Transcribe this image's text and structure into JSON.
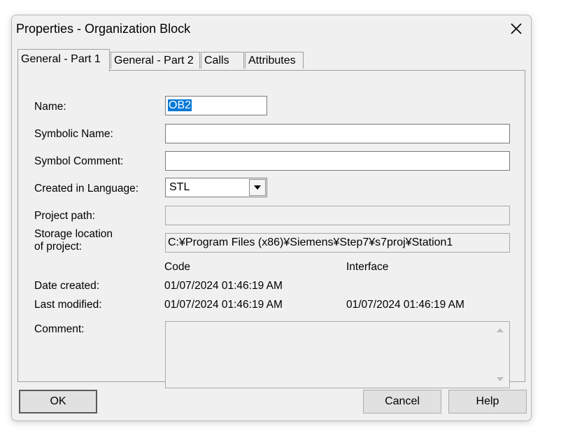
{
  "dialog": {
    "title": "Properties - Organization Block"
  },
  "tabs": [
    {
      "label": "General - Part 1",
      "active": true
    },
    {
      "label": "General - Part 2",
      "active": false
    },
    {
      "label": "Calls",
      "active": false
    },
    {
      "label": "Attributes",
      "active": false
    }
  ],
  "form": {
    "name_label": "Name:",
    "name_value": "OB2",
    "symbolic_name_label": "Symbolic Name:",
    "symbolic_name_value": "",
    "symbol_comment_label": "Symbol Comment:",
    "symbol_comment_value": "",
    "language_label": "Created in Language:",
    "language_value": "STL",
    "project_path_label": "Project path:",
    "project_path_value": "",
    "storage_label_line1": "Storage location",
    "storage_label_line2": "of project:",
    "storage_value": "C:¥Program Files (x86)¥Siemens¥Step7¥s7proj¥Station1",
    "code_header": "Code",
    "interface_header": "Interface",
    "date_created_label": "Date created:",
    "date_created_code": "01/07/2024 01:46:19 AM",
    "last_modified_label": "Last modified:",
    "last_modified_code": "01/07/2024 01:46:19 AM",
    "last_modified_interface": "01/07/2024 01:46:19 AM",
    "comment_label": "Comment:",
    "comment_value": ""
  },
  "buttons": {
    "ok": "OK",
    "cancel": "Cancel",
    "help": "Help"
  },
  "colors": {
    "selection": "#0078d7",
    "dialog_bg": "#f0f0f0"
  }
}
